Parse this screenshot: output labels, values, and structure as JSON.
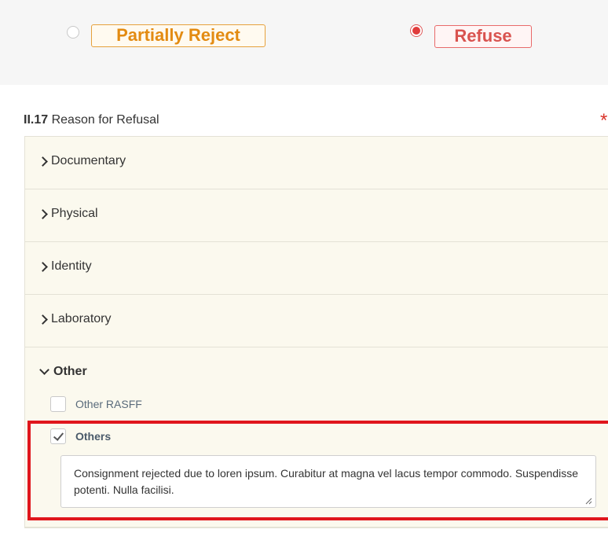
{
  "decision": {
    "options": [
      {
        "label": "Partially Reject",
        "selected": false
      },
      {
        "label": "Refuse",
        "selected": true
      }
    ]
  },
  "section": {
    "number": "II.17",
    "title": "Reason for Refusal",
    "required_mark": "*"
  },
  "accordion": {
    "items": [
      {
        "label": "Documentary",
        "expanded": false
      },
      {
        "label": "Physical",
        "expanded": false
      },
      {
        "label": "Identity",
        "expanded": false
      },
      {
        "label": "Laboratory",
        "expanded": false
      },
      {
        "label": "Other",
        "expanded": true
      }
    ]
  },
  "other": {
    "checkboxes": [
      {
        "label": "Other RASFF",
        "checked": false
      },
      {
        "label": "Others",
        "checked": true
      }
    ],
    "others_text": "Consignment rejected due to loren ipsum. Curabitur at magna vel lacus tempor commodo. Suspendisse potenti. Nulla facilisi."
  },
  "colors": {
    "partial_reject": "#e38b12",
    "refuse": "#d9534f",
    "highlight": "#e0161c",
    "accordion_bg": "#fbf9ee"
  }
}
